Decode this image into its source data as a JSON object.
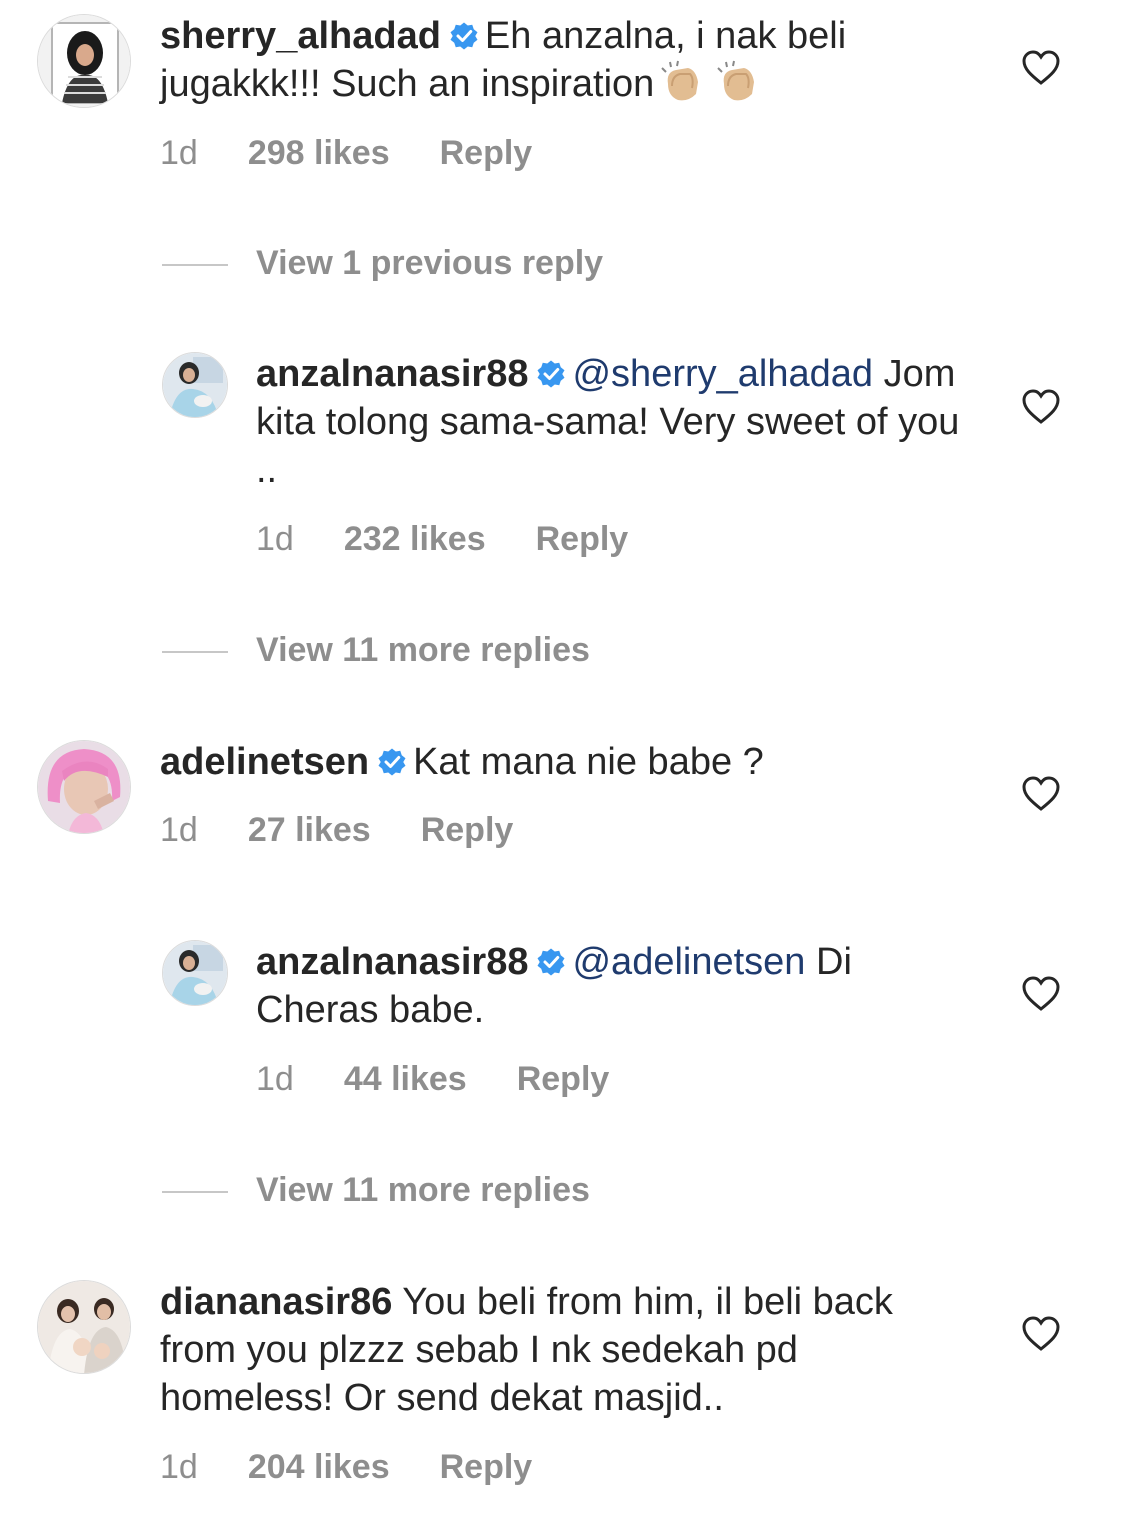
{
  "comments": [
    {
      "username": "sherry_alhadad",
      "body": "Eh anzalna, i nak beli jugakkk!!! Such an inspiration",
      "time": "1d",
      "likes": "298 likes",
      "reply": "Reply",
      "view_replies": "View 1 previous reply",
      "emoji": "clapping-hands x2"
    },
    {
      "username": "anzalnanasir88",
      "mention": "@sherry_alhadad",
      "body": "Jom kita tolong sama-sama! Very sweet of you ..",
      "time": "1d",
      "likes": "232 likes",
      "reply": "Reply",
      "view_replies": "View 11 more replies"
    },
    {
      "username": "adelinetsen",
      "body": "Kat mana nie babe ?",
      "time": "1d",
      "likes": "27 likes",
      "reply": "Reply"
    },
    {
      "username": "anzalnanasir88",
      "mention": "@adelinetsen",
      "body": "Di Cheras babe.",
      "time": "1d",
      "likes": "44 likes",
      "reply": "Reply",
      "view_replies": "View 11 more replies"
    },
    {
      "username": "diananasir86",
      "body": "You beli from him, il beli back from you plzzz sebab I nk sedekah pd homeless! Or send dekat masjid..",
      "time": "1d",
      "likes": "204 likes",
      "reply": "Reply"
    }
  ],
  "colors": {
    "text": "#262626",
    "meta": "#8e8e8e",
    "mention": "#1f3b6e",
    "verified": "#3897f0"
  },
  "icons": [
    "verified-badge-icon",
    "heart-icon",
    "clapping-hands-emoji"
  ]
}
